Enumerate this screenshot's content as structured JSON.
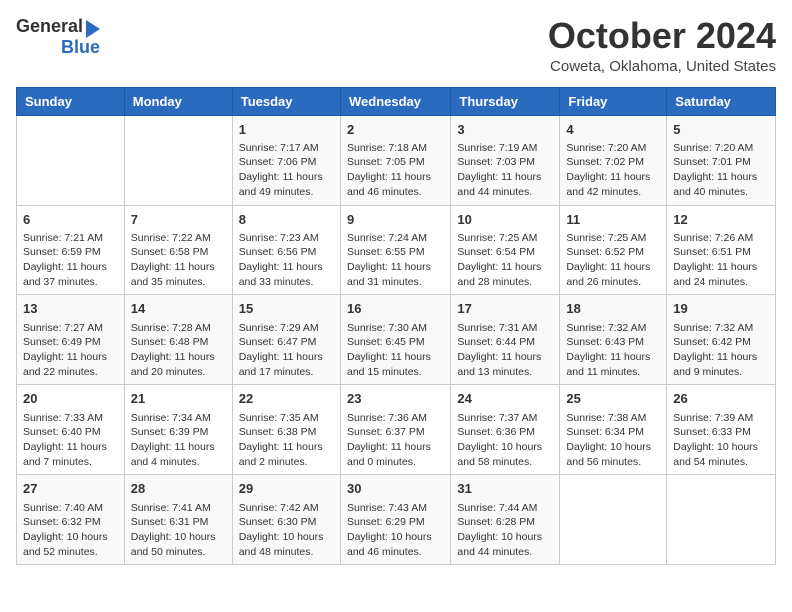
{
  "logo": {
    "line1": "General",
    "line2": "Blue"
  },
  "title": "October 2024",
  "location": "Coweta, Oklahoma, United States",
  "days_of_week": [
    "Sunday",
    "Monday",
    "Tuesday",
    "Wednesday",
    "Thursday",
    "Friday",
    "Saturday"
  ],
  "weeks": [
    [
      {
        "day": "",
        "info": ""
      },
      {
        "day": "",
        "info": ""
      },
      {
        "day": "1",
        "info": "Sunrise: 7:17 AM\nSunset: 7:06 PM\nDaylight: 11 hours and 49 minutes."
      },
      {
        "day": "2",
        "info": "Sunrise: 7:18 AM\nSunset: 7:05 PM\nDaylight: 11 hours and 46 minutes."
      },
      {
        "day": "3",
        "info": "Sunrise: 7:19 AM\nSunset: 7:03 PM\nDaylight: 11 hours and 44 minutes."
      },
      {
        "day": "4",
        "info": "Sunrise: 7:20 AM\nSunset: 7:02 PM\nDaylight: 11 hours and 42 minutes."
      },
      {
        "day": "5",
        "info": "Sunrise: 7:20 AM\nSunset: 7:01 PM\nDaylight: 11 hours and 40 minutes."
      }
    ],
    [
      {
        "day": "6",
        "info": "Sunrise: 7:21 AM\nSunset: 6:59 PM\nDaylight: 11 hours and 37 minutes."
      },
      {
        "day": "7",
        "info": "Sunrise: 7:22 AM\nSunset: 6:58 PM\nDaylight: 11 hours and 35 minutes."
      },
      {
        "day": "8",
        "info": "Sunrise: 7:23 AM\nSunset: 6:56 PM\nDaylight: 11 hours and 33 minutes."
      },
      {
        "day": "9",
        "info": "Sunrise: 7:24 AM\nSunset: 6:55 PM\nDaylight: 11 hours and 31 minutes."
      },
      {
        "day": "10",
        "info": "Sunrise: 7:25 AM\nSunset: 6:54 PM\nDaylight: 11 hours and 28 minutes."
      },
      {
        "day": "11",
        "info": "Sunrise: 7:25 AM\nSunset: 6:52 PM\nDaylight: 11 hours and 26 minutes."
      },
      {
        "day": "12",
        "info": "Sunrise: 7:26 AM\nSunset: 6:51 PM\nDaylight: 11 hours and 24 minutes."
      }
    ],
    [
      {
        "day": "13",
        "info": "Sunrise: 7:27 AM\nSunset: 6:49 PM\nDaylight: 11 hours and 22 minutes."
      },
      {
        "day": "14",
        "info": "Sunrise: 7:28 AM\nSunset: 6:48 PM\nDaylight: 11 hours and 20 minutes."
      },
      {
        "day": "15",
        "info": "Sunrise: 7:29 AM\nSunset: 6:47 PM\nDaylight: 11 hours and 17 minutes."
      },
      {
        "day": "16",
        "info": "Sunrise: 7:30 AM\nSunset: 6:45 PM\nDaylight: 11 hours and 15 minutes."
      },
      {
        "day": "17",
        "info": "Sunrise: 7:31 AM\nSunset: 6:44 PM\nDaylight: 11 hours and 13 minutes."
      },
      {
        "day": "18",
        "info": "Sunrise: 7:32 AM\nSunset: 6:43 PM\nDaylight: 11 hours and 11 minutes."
      },
      {
        "day": "19",
        "info": "Sunrise: 7:32 AM\nSunset: 6:42 PM\nDaylight: 11 hours and 9 minutes."
      }
    ],
    [
      {
        "day": "20",
        "info": "Sunrise: 7:33 AM\nSunset: 6:40 PM\nDaylight: 11 hours and 7 minutes."
      },
      {
        "day": "21",
        "info": "Sunrise: 7:34 AM\nSunset: 6:39 PM\nDaylight: 11 hours and 4 minutes."
      },
      {
        "day": "22",
        "info": "Sunrise: 7:35 AM\nSunset: 6:38 PM\nDaylight: 11 hours and 2 minutes."
      },
      {
        "day": "23",
        "info": "Sunrise: 7:36 AM\nSunset: 6:37 PM\nDaylight: 11 hours and 0 minutes."
      },
      {
        "day": "24",
        "info": "Sunrise: 7:37 AM\nSunset: 6:36 PM\nDaylight: 10 hours and 58 minutes."
      },
      {
        "day": "25",
        "info": "Sunrise: 7:38 AM\nSunset: 6:34 PM\nDaylight: 10 hours and 56 minutes."
      },
      {
        "day": "26",
        "info": "Sunrise: 7:39 AM\nSunset: 6:33 PM\nDaylight: 10 hours and 54 minutes."
      }
    ],
    [
      {
        "day": "27",
        "info": "Sunrise: 7:40 AM\nSunset: 6:32 PM\nDaylight: 10 hours and 52 minutes."
      },
      {
        "day": "28",
        "info": "Sunrise: 7:41 AM\nSunset: 6:31 PM\nDaylight: 10 hours and 50 minutes."
      },
      {
        "day": "29",
        "info": "Sunrise: 7:42 AM\nSunset: 6:30 PM\nDaylight: 10 hours and 48 minutes."
      },
      {
        "day": "30",
        "info": "Sunrise: 7:43 AM\nSunset: 6:29 PM\nDaylight: 10 hours and 46 minutes."
      },
      {
        "day": "31",
        "info": "Sunrise: 7:44 AM\nSunset: 6:28 PM\nDaylight: 10 hours and 44 minutes."
      },
      {
        "day": "",
        "info": ""
      },
      {
        "day": "",
        "info": ""
      }
    ]
  ]
}
